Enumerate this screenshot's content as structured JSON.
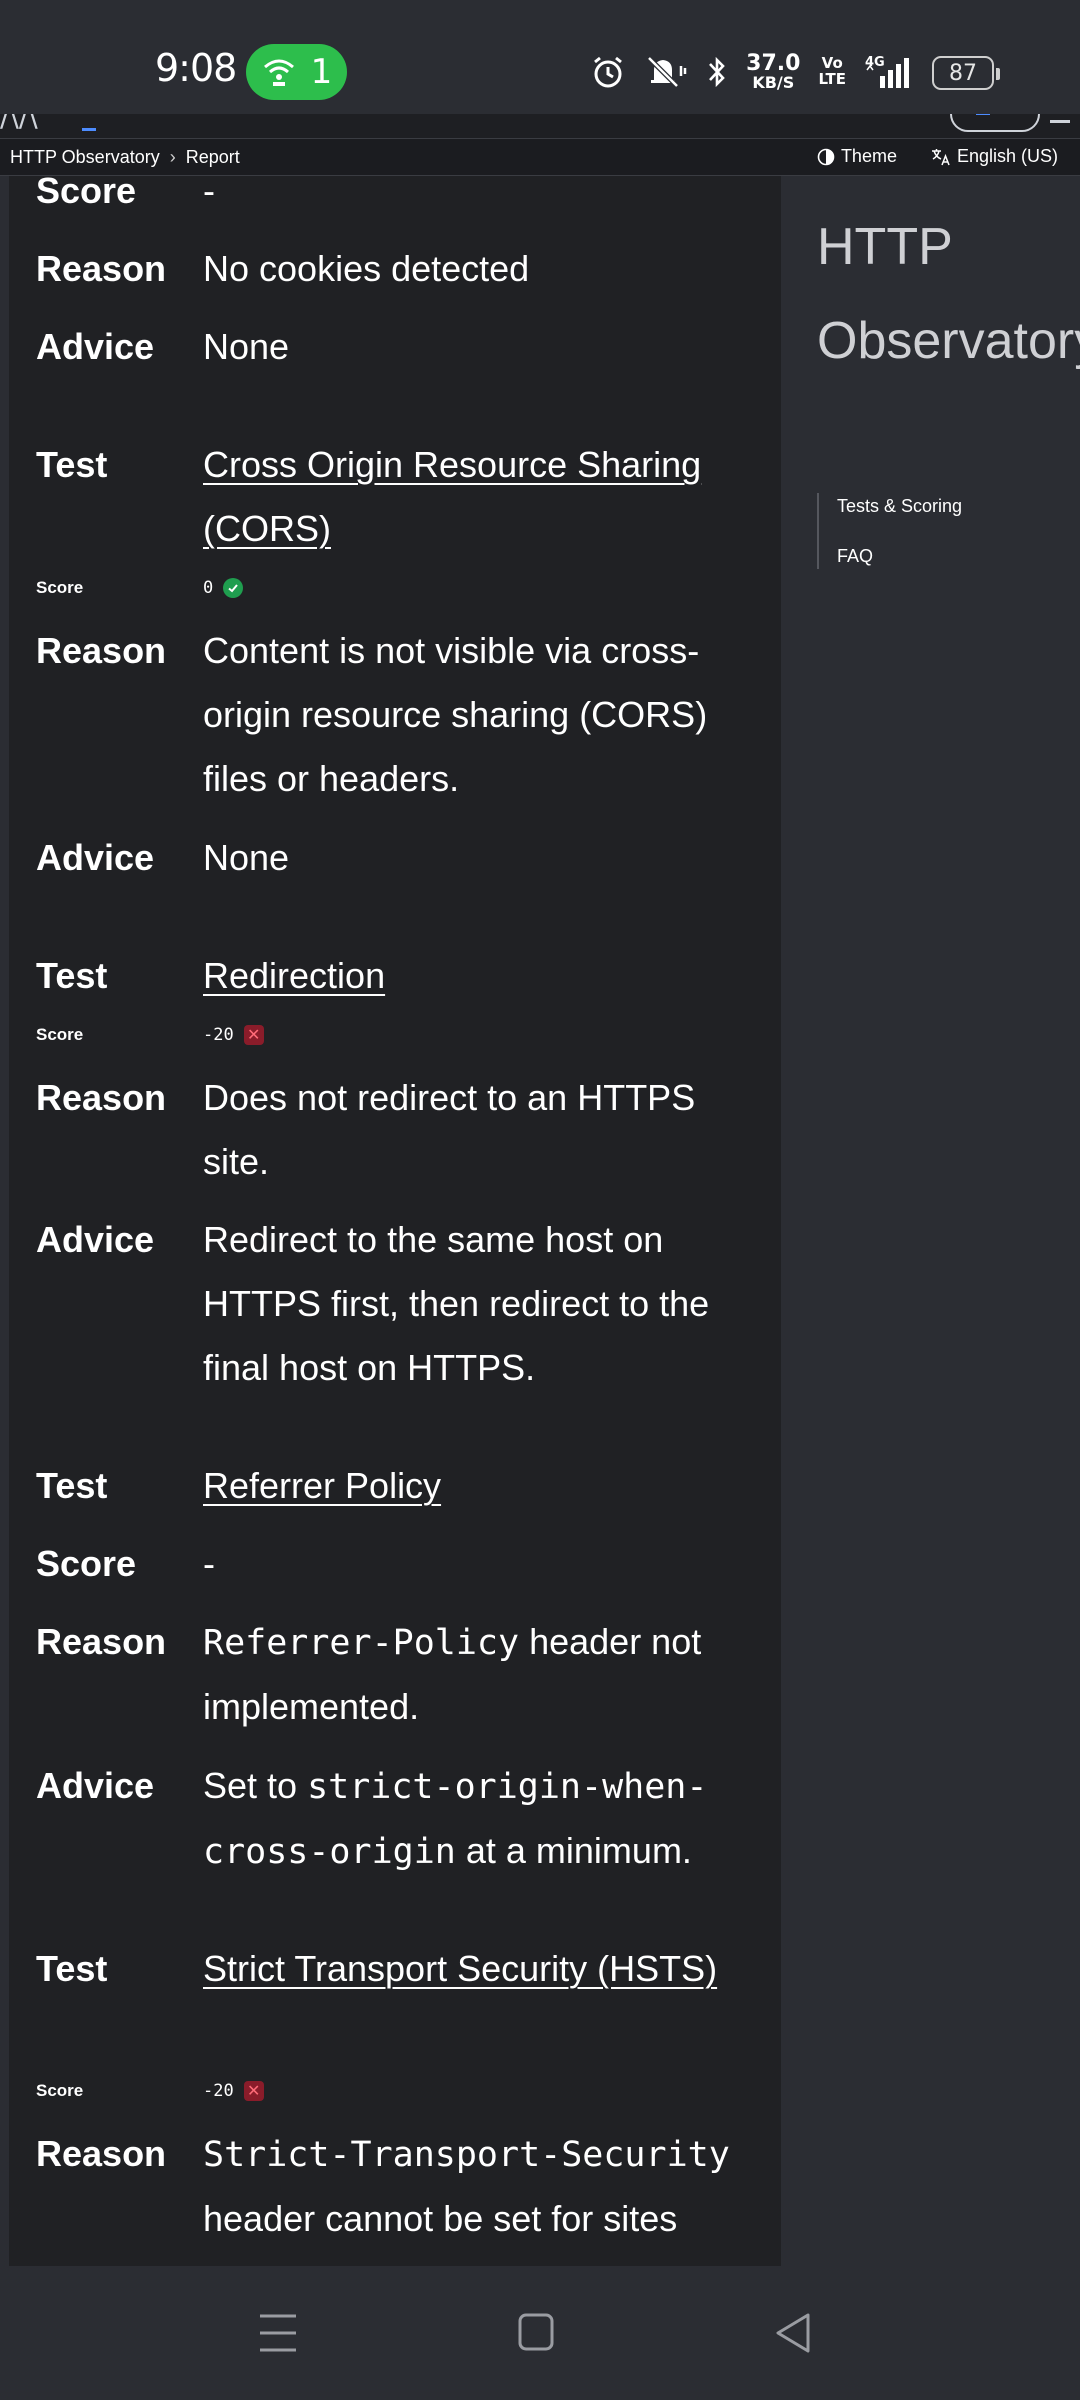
{
  "status_bar": {
    "time": "9:08",
    "hotspot_count": "1",
    "net_speed_value": "37.0",
    "net_speed_unit": "KB/S",
    "volte_top": "Vo",
    "volte_bottom": "LTE",
    "signal_label": "4G",
    "battery": "87"
  },
  "header": {
    "breadcrumb": [
      "HTTP Observatory",
      "Report"
    ],
    "theme_label": "Theme",
    "language_label": "English (US)"
  },
  "report": {
    "labels": {
      "test": "Test",
      "score": "Score",
      "reason": "Reason",
      "advice": "Advice"
    },
    "cookies": {
      "score": "-",
      "reason": "No cookies detected",
      "advice": "None"
    },
    "cors": {
      "test": "Cross Origin Resource Sharing (CORS)",
      "score": "0",
      "reason": "Content is not visible via cross-origin resource sharing (CORS) files or headers.",
      "advice": "None"
    },
    "redirection": {
      "test": "Redirection",
      "score": "-20",
      "reason": "Does not redirect to an HTTPS site.",
      "advice": "Redirect to the same host on HTTPS first, then redirect to the final host on HTTPS."
    },
    "referrer": {
      "test": "Referrer Policy",
      "score": "-",
      "reason_code": "Referrer-Policy",
      "reason_text": " header not implemented.",
      "advice_prefix": "Set to ",
      "advice_code": "strict-origin-when-cross-origin",
      "advice_suffix": " at a minimum."
    },
    "hsts": {
      "test": "Strict Transport Security (HSTS)",
      "score": "-20",
      "reason_code": "Strict-Transport-Security",
      "reason_text": "header cannot be set for sites"
    }
  },
  "sidebar": {
    "title": "HTTP Observatory",
    "nav": [
      "Tests & Scoring",
      "FAQ"
    ]
  }
}
